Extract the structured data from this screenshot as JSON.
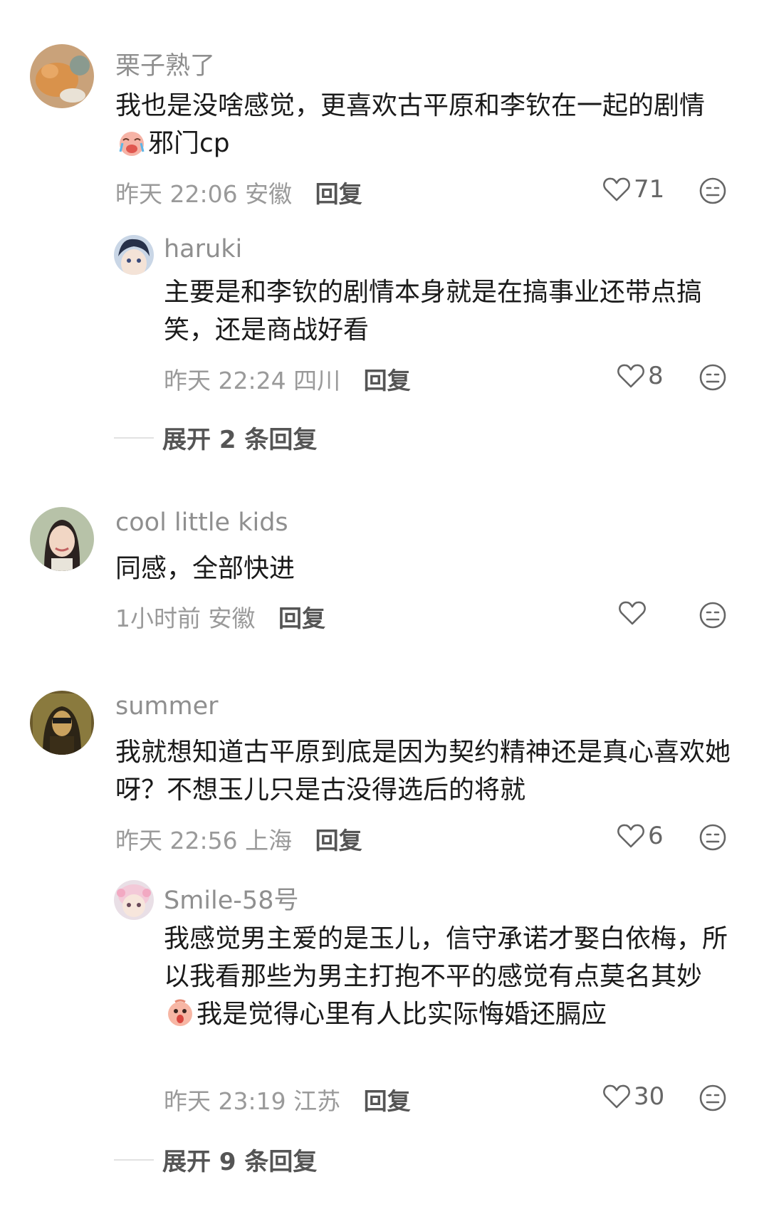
{
  "comments": [
    {
      "username": "栗子熟了",
      "text_a": "我也是没啥感觉，更喜欢古平原和李钦在一起的剧情",
      "text_b": "邪门cp",
      "time": "昨天 22:06",
      "location": "安徽",
      "reply_label": "回复",
      "likes": "71",
      "avatar_icon": "cat-avatar",
      "reply": {
        "username": "haruki",
        "text": "主要是和李钦的剧情本身就是在搞事业还带点搞笑，还是商战好看",
        "time": "昨天 22:24",
        "location": "四川",
        "reply_label": "回复",
        "likes": "8",
        "avatar_icon": "anime-boy-avatar"
      },
      "expand_label": "展开 2 条回复"
    },
    {
      "username": "cool little kids",
      "text": "同感，全部快进",
      "time": "1小时前",
      "location": "安徽",
      "reply_label": "回复",
      "likes": "",
      "avatar_icon": "woman-avatar"
    },
    {
      "username": "summer",
      "text": "我就想知道古平原到底是因为契约精神还是真心喜欢她呀？不想玉儿只是古没得选后的将就",
      "time": "昨天 22:56",
      "location": "上海",
      "reply_label": "回复",
      "likes": "6",
      "avatar_icon": "mona-lisa-avatar",
      "reply": {
        "username": "Smile-58号",
        "text_a": "我感觉男主爱的是玉儿，信守承诺才娶白依梅，所以我看那些为男主打抱不平的感觉有点莫名其妙",
        "text_b": "我是觉得心里有人比实际悔婚还膈应",
        "time": "昨天 23:19",
        "location": "江苏",
        "reply_label": "回复",
        "likes": "30",
        "avatar_icon": "doll-avatar"
      },
      "expand_label": "展开 9 条回复"
    }
  ],
  "colors": {
    "username": "#8f8f8f",
    "text": "#1a1a1a",
    "meta": "#9a9a9a",
    "reply": "#555555"
  }
}
